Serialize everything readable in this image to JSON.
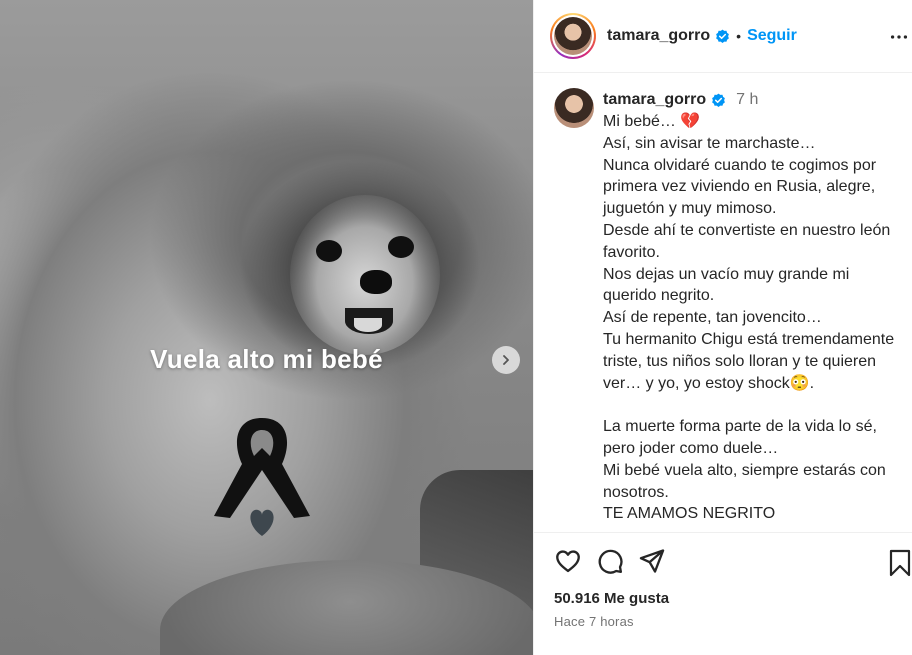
{
  "post": {
    "image_caption": "Vuela alto mi bebé",
    "image_alt": "Foto en blanco y negro de un perro pomerania"
  },
  "header": {
    "username": "tamara_gorro",
    "separator": "•",
    "follow_label": "Seguir"
  },
  "caption": {
    "username": "tamara_gorro",
    "time": "7 h",
    "first_line": "Mi bebé… ",
    "emoji_heart": "💔",
    "body_a": "Así, sin avisar te marchaste…\nNunca olvidaré cuando te cogimos por primera vez viviendo en Rusia, alegre, juguetón y muy mimoso.\nDesde ahí te convertiste en nuestro león favorito.\nNos dejas un vacío muy grande mi querido negrito.\nAsí de repente, tan jovencito…\nTu hermanito Chigu está tremendamente triste, tus niños solo lloran y te quieren ver… y yo, yo estoy shock",
    "emoji_face": "😳",
    "body_a_end": ".",
    "body_b": "\nLa muerte forma parte de la vida lo sé, pero joder como duele…\nMi bebé vuela alto, siempre estarás con nosotros.\nTE AMAMOS NEGRITO"
  },
  "footer": {
    "likes": "50.916 Me gusta",
    "time_ago": "Hace 7 horas"
  },
  "icons": {
    "verified": "verified-badge-icon",
    "more": "more-options-icon",
    "like": "heart-icon",
    "comment": "comment-icon",
    "share": "share-icon",
    "save": "bookmark-icon",
    "next": "chevron-right-icon",
    "ribbon": "mourning-ribbon-icon"
  },
  "colors": {
    "accent": "#0095f6",
    "text": "#262626",
    "muted": "#737373"
  }
}
